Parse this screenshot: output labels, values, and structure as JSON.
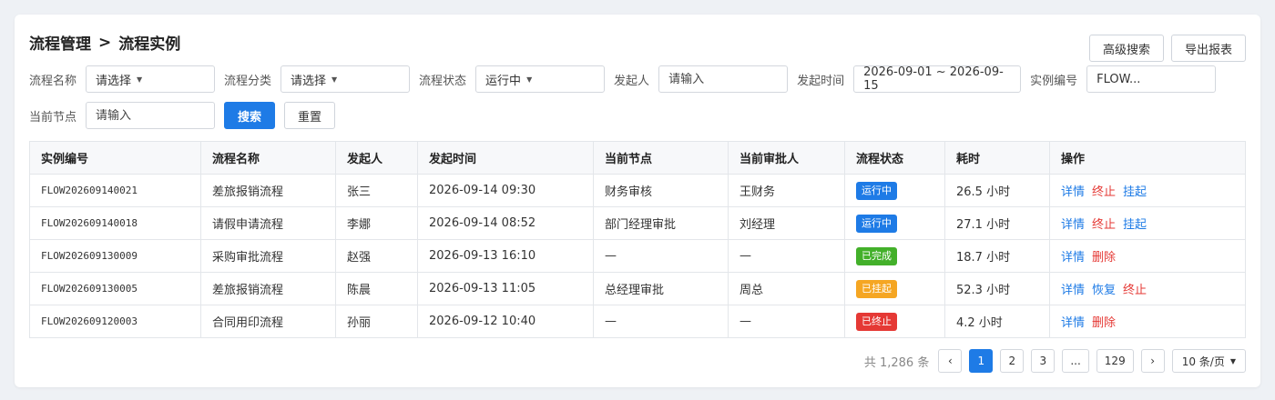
{
  "breadcrumb": {
    "parent": "流程管理",
    "separator": ">",
    "current": "流程实例"
  },
  "top_actions": {
    "advanced_search": "高级搜索",
    "export": "导出报表"
  },
  "filters": {
    "process_name": {
      "label": "流程名称",
      "value": "请选择"
    },
    "process_category": {
      "label": "流程分类",
      "value": "请选择"
    },
    "process_status": {
      "label": "流程状态",
      "value": "运行中"
    },
    "initiator": {
      "label": "发起人",
      "placeholder": "请输入"
    },
    "start_time": {
      "label": "发起时间",
      "value": "2026-09-01 ~ 2026-09-15"
    },
    "instance_no": {
      "label": "实例编号",
      "value": "FLOW..."
    },
    "current_node": {
      "label": "当前节点",
      "placeholder": "请输入"
    },
    "search_label": "搜索",
    "reset_label": "重置"
  },
  "table": {
    "columns": [
      "实例编号",
      "流程名称",
      "发起人",
      "发起时间",
      "当前节点",
      "当前审批人",
      "流程状态",
      "耗时",
      "操作"
    ],
    "rows": [
      {
        "id": "FLOW202609140021",
        "name": "差旅报销流程",
        "initiator": "张三",
        "time": "2026-09-14 09:30",
        "node": "财务审核",
        "approver": "王财务",
        "status": "运行中",
        "status_color": "#1e7be6",
        "duration": "26.5 小时",
        "actions": [
          {
            "label": "详情",
            "color": "#1e7be6"
          },
          {
            "label": "终止",
            "color": "#e53935"
          },
          {
            "label": "挂起",
            "color": "#1e7be6"
          }
        ]
      },
      {
        "id": "FLOW202609140018",
        "name": "请假申请流程",
        "initiator": "李娜",
        "time": "2026-09-14 08:52",
        "node": "部门经理审批",
        "approver": "刘经理",
        "status": "运行中",
        "status_color": "#1e7be6",
        "duration": "27.1 小时",
        "actions": [
          {
            "label": "详情",
            "color": "#1e7be6"
          },
          {
            "label": "终止",
            "color": "#e53935"
          },
          {
            "label": "挂起",
            "color": "#1e7be6"
          }
        ]
      },
      {
        "id": "FLOW202609130009",
        "name": "采购审批流程",
        "initiator": "赵强",
        "time": "2026-09-13 16:10",
        "node": "—",
        "approver": "—",
        "status": "已完成",
        "status_color": "#43b02a",
        "duration": "18.7 小时",
        "actions": [
          {
            "label": "详情",
            "color": "#1e7be6"
          },
          {
            "label": "删除",
            "color": "#e53935"
          }
        ]
      },
      {
        "id": "FLOW202609130005",
        "name": "差旅报销流程",
        "initiator": "陈晨",
        "time": "2026-09-13 11:05",
        "node": "总经理审批",
        "approver": "周总",
        "status": "已挂起",
        "status_color": "#f5a623",
        "duration": "52.3 小时",
        "actions": [
          {
            "label": "详情",
            "color": "#1e7be6"
          },
          {
            "label": "恢复",
            "color": "#1e7be6"
          },
          {
            "label": "终止",
            "color": "#e53935"
          }
        ]
      },
      {
        "id": "FLOW202609120003",
        "name": "合同用印流程",
        "initiator": "孙丽",
        "time": "2026-09-12 10:40",
        "node": "—",
        "approver": "—",
        "status": "已终止",
        "status_color": "#e53935",
        "duration": "4.2 小时",
        "actions": [
          {
            "label": "详情",
            "color": "#1e7be6"
          },
          {
            "label": "删除",
            "color": "#e53935"
          }
        ]
      }
    ]
  },
  "pagination": {
    "total": "共 1,286 条",
    "prev": "‹",
    "pages": [
      "1",
      "2",
      "3",
      "...",
      "129"
    ],
    "current": "1",
    "next": "›",
    "page_size": "10 条/页"
  }
}
